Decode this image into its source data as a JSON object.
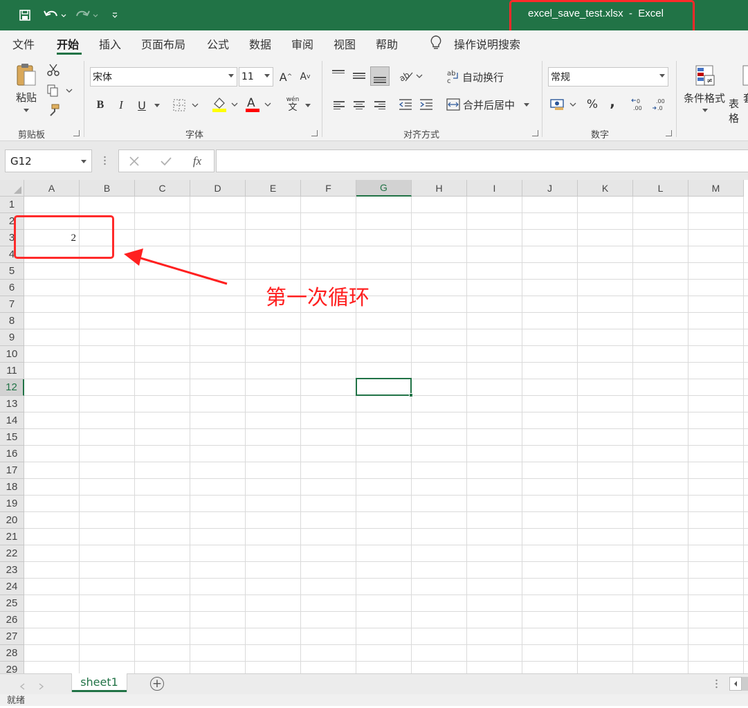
{
  "window": {
    "title": "excel_save_test.xlsx  -  Excel",
    "accent": "#217346",
    "quick_access": [
      "save-icon",
      "undo-icon",
      "redo-icon",
      "customize-icon"
    ]
  },
  "ribbon_tabs": {
    "file": "文件",
    "home": "开始",
    "insert": "插入",
    "page_layout": "页面布局",
    "formulas": "公式",
    "data": "数据",
    "review": "审阅",
    "view": "视图",
    "help": "帮助",
    "tell_me": "操作说明搜索",
    "active": "开始"
  },
  "ribbon": {
    "clipboard": {
      "label": "剪贴板",
      "paste": "粘贴"
    },
    "font": {
      "label": "字体",
      "name": "宋体",
      "size": "11",
      "bold": "B",
      "italic": "I",
      "underline": "U",
      "phonetic_top": "wén",
      "phonetic_bottom": "文",
      "grow": "A",
      "shrink": "A"
    },
    "alignment": {
      "label": "对齐方式",
      "wrap_text": "自动换行",
      "merge_center": "合并后居中"
    },
    "number": {
      "label": "数字",
      "format": "常规",
      "percent": "%",
      "comma": ","
    },
    "styles": {
      "conditional": "条件格式",
      "table_partial_1": "套",
      "table_partial_2": "表格"
    }
  },
  "formula_bar": {
    "name_box": "G12",
    "fx": "fx",
    "value": ""
  },
  "sheet": {
    "columns": [
      "A",
      "B",
      "C",
      "D",
      "E",
      "F",
      "G",
      "H",
      "I",
      "J",
      "K",
      "L",
      "M"
    ],
    "rows": [
      "1",
      "2",
      "3",
      "4",
      "5",
      "6",
      "7",
      "8",
      "9",
      "10",
      "11",
      "12",
      "13",
      "14",
      "15",
      "16",
      "17",
      "18",
      "19",
      "20",
      "21",
      "22",
      "23",
      "24",
      "25",
      "26",
      "27",
      "28",
      "29"
    ],
    "selected_column": "G",
    "selected_row": "12",
    "cells": {
      "A3": "2"
    }
  },
  "annotation": {
    "text": "第一次循环",
    "color": "#ff2020"
  },
  "sheet_tabs": {
    "active": "sheet1",
    "add": "+"
  },
  "status": {
    "text": "就绪"
  }
}
